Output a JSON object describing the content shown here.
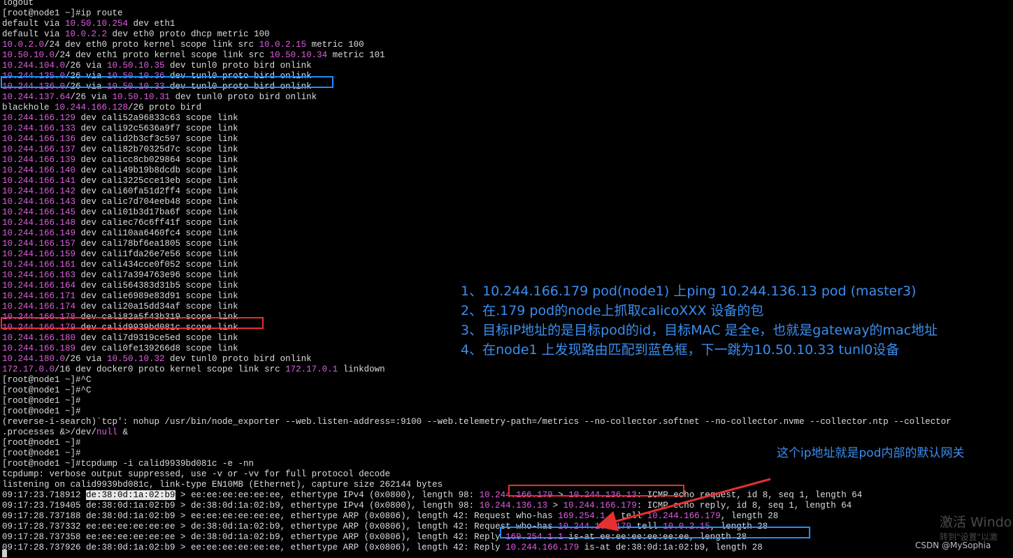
{
  "terminal": {
    "lines": [
      {
        "parts": [
          {
            "t": "logout"
          }
        ]
      },
      {
        "parts": [
          {
            "t": "[root@node1 ~]#ip route"
          }
        ]
      },
      {
        "parts": [
          {
            "t": "default via "
          },
          {
            "t": "10.50.10.254",
            "c": "ip"
          },
          {
            "t": " dev eth1"
          }
        ]
      },
      {
        "parts": [
          {
            "t": "default via "
          },
          {
            "t": "10.0.2.2",
            "c": "ip"
          },
          {
            "t": " dev eth0 proto dhcp metric 100"
          }
        ]
      },
      {
        "parts": [
          {
            "t": "10.0.2.0",
            "c": "ip"
          },
          {
            "t": "/24 dev eth0 proto kernel scope link src "
          },
          {
            "t": "10.0.2.15",
            "c": "ip"
          },
          {
            "t": " metric 100"
          }
        ]
      },
      {
        "parts": [
          {
            "t": "10.50.10.0",
            "c": "ip"
          },
          {
            "t": "/24 dev eth1 proto kernel scope link src "
          },
          {
            "t": "10.50.10.34",
            "c": "ip"
          },
          {
            "t": " metric 101"
          }
        ]
      },
      {
        "parts": [
          {
            "t": "10.244.104.0",
            "c": "ip"
          },
          {
            "t": "/26 via "
          },
          {
            "t": "10.50.10.35",
            "c": "ip"
          },
          {
            "t": " dev tunl0 proto bird onlink"
          }
        ]
      },
      {
        "parts": [
          {
            "t": "10.244.135.0",
            "c": "ip"
          },
          {
            "t": "/26 via "
          },
          {
            "t": "10.50.10.36",
            "c": "ip"
          },
          {
            "t": " dev tunl0 proto bird onlink"
          }
        ]
      },
      {
        "parts": [
          {
            "t": "10.244.136.0",
            "c": "ip"
          },
          {
            "t": "/26 via "
          },
          {
            "t": "10.50.10.33",
            "c": "ip"
          },
          {
            "t": " dev tunl0 proto bird onlink"
          }
        ]
      },
      {
        "parts": [
          {
            "t": "10.244.137.64",
            "c": "ip"
          },
          {
            "t": "/26 via "
          },
          {
            "t": "10.50.10.31",
            "c": "ip"
          },
          {
            "t": " dev tunl0 proto bird onlink"
          }
        ]
      },
      {
        "parts": [
          {
            "t": "blackhole "
          },
          {
            "t": "10.244.166.128",
            "c": "ip"
          },
          {
            "t": "/26 proto bird"
          }
        ]
      },
      {
        "parts": [
          {
            "t": "10.244.166.129",
            "c": "ip"
          },
          {
            "t": " dev cali52a96833c63 scope link"
          }
        ]
      },
      {
        "parts": [
          {
            "t": "10.244.166.133",
            "c": "ip"
          },
          {
            "t": " dev cali92c5636a9f7 scope link"
          }
        ]
      },
      {
        "parts": [
          {
            "t": "10.244.166.136",
            "c": "ip"
          },
          {
            "t": " dev calid2b3cf3c597 scope link"
          }
        ]
      },
      {
        "parts": [
          {
            "t": "10.244.166.137",
            "c": "ip"
          },
          {
            "t": " dev cali82b70325d7c scope link"
          }
        ]
      },
      {
        "parts": [
          {
            "t": "10.244.166.139",
            "c": "ip"
          },
          {
            "t": " dev calicc8cb029864 scope link"
          }
        ]
      },
      {
        "parts": [
          {
            "t": "10.244.166.140",
            "c": "ip"
          },
          {
            "t": " dev cali49b19b8dcdb scope link"
          }
        ]
      },
      {
        "parts": [
          {
            "t": "10.244.166.141",
            "c": "ip"
          },
          {
            "t": " dev cali3225cce13eb scope link"
          }
        ]
      },
      {
        "parts": [
          {
            "t": "10.244.166.142",
            "c": "ip"
          },
          {
            "t": " dev cali60fa51d2ff4 scope link"
          }
        ]
      },
      {
        "parts": [
          {
            "t": "10.244.166.143",
            "c": "ip"
          },
          {
            "t": " dev calic7d704eeb48 scope link"
          }
        ]
      },
      {
        "parts": [
          {
            "t": "10.244.166.145",
            "c": "ip"
          },
          {
            "t": " dev cali01b3d17ba6f scope link"
          }
        ]
      },
      {
        "parts": [
          {
            "t": "10.244.166.148",
            "c": "ip"
          },
          {
            "t": " dev caliec76c6ff41f scope link"
          }
        ]
      },
      {
        "parts": [
          {
            "t": "10.244.166.149",
            "c": "ip"
          },
          {
            "t": " dev cali10aa6460fc4 scope link"
          }
        ]
      },
      {
        "parts": [
          {
            "t": "10.244.166.157",
            "c": "ip"
          },
          {
            "t": " dev cali78bf6ea1805 scope link"
          }
        ]
      },
      {
        "parts": [
          {
            "t": "10.244.166.159",
            "c": "ip"
          },
          {
            "t": " dev cali1fda26e7e56 scope link"
          }
        ]
      },
      {
        "parts": [
          {
            "t": "10.244.166.161",
            "c": "ip"
          },
          {
            "t": " dev cali434cce0f052 scope link"
          }
        ]
      },
      {
        "parts": [
          {
            "t": "10.244.166.163",
            "c": "ip"
          },
          {
            "t": " dev cali7a394763e96 scope link"
          }
        ]
      },
      {
        "parts": [
          {
            "t": "10.244.166.164",
            "c": "ip"
          },
          {
            "t": " dev cali564383d31b5 scope link"
          }
        ]
      },
      {
        "parts": [
          {
            "t": "10.244.166.171",
            "c": "ip"
          },
          {
            "t": " dev calie6989e83d91 scope link"
          }
        ]
      },
      {
        "parts": [
          {
            "t": "10.244.166.174",
            "c": "ip"
          },
          {
            "t": " dev cali20a15dd34af scope link"
          }
        ]
      },
      {
        "parts": [
          {
            "t": "10.244.166.178",
            "c": "ip"
          },
          {
            "t": " dev cali82a5f43b319 scope link"
          }
        ]
      },
      {
        "parts": [
          {
            "t": "10.244.166.179",
            "c": "ip"
          },
          {
            "t": " dev calid9939bd081c scope link"
          }
        ]
      },
      {
        "parts": [
          {
            "t": "10.244.166.180",
            "c": "ip"
          },
          {
            "t": " dev cali7d9319ce5ed scope link"
          }
        ]
      },
      {
        "parts": [
          {
            "t": "10.244.166.189",
            "c": "ip"
          },
          {
            "t": " dev cali0fe139266d8 scope link"
          }
        ]
      },
      {
        "parts": [
          {
            "t": "10.244.180.0",
            "c": "ip"
          },
          {
            "t": "/26 via "
          },
          {
            "t": "10.50.10.32",
            "c": "ip"
          },
          {
            "t": " dev tunl0 proto bird onlink"
          }
        ]
      },
      {
        "parts": [
          {
            "t": "172.17.0.0",
            "c": "ip"
          },
          {
            "t": "/16 dev docker0 proto kernel scope link src "
          },
          {
            "t": "172.17.0.1",
            "c": "ip"
          },
          {
            "t": " linkdown"
          }
        ]
      },
      {
        "parts": [
          {
            "t": "[root@node1 ~]#^C"
          }
        ]
      },
      {
        "parts": [
          {
            "t": "[root@node1 ~]#^C"
          }
        ]
      },
      {
        "parts": [
          {
            "t": "[root@node1 ~]#"
          }
        ]
      },
      {
        "parts": [
          {
            "t": "[root@node1 ~]#"
          }
        ]
      },
      {
        "parts": [
          {
            "t": "(reverse-i-search)`tcp': nohup /usr/bin/node_exporter --web.listen-address=:9100 --web.telemetry-path=/metrics --no-collector.softnet --no-collector.nvme --collector.ntp --collector"
          }
        ]
      },
      {
        "parts": [
          {
            "t": ".processes &>/dev/"
          },
          {
            "t": "null",
            "c": "ip"
          },
          {
            "t": " &"
          }
        ]
      },
      {
        "parts": [
          {
            "t": "[root@node1 ~]#"
          }
        ]
      },
      {
        "parts": [
          {
            "t": "[root@node1 ~]#"
          }
        ]
      },
      {
        "parts": [
          {
            "t": "[root@node1 ~]#tcpdump -i calid9939bd081c -e -nn"
          }
        ]
      },
      {
        "parts": [
          {
            "t": "tcpdump: verbose output suppressed, use -v or -vv for full protocol decode"
          }
        ]
      },
      {
        "parts": [
          {
            "t": "listening on calid9939bd081c, link-type EN10MB (Ethernet), capture size 262144 bytes"
          }
        ]
      },
      {
        "parts": [
          {
            "t": "09:17:23.718912 "
          },
          {
            "t": "de:38:0d:1a:02:b9",
            "c": "sel"
          },
          {
            "t": " > ee:ee:ee:ee:ee:ee, ethertype IPv4 (0x0800), length 98: "
          },
          {
            "t": "10.244.166.179",
            "c": "ip"
          },
          {
            "t": " > "
          },
          {
            "t": "10.244.136.13",
            "c": "ip"
          },
          {
            "t": ": ICMP echo request, id 8, seq 1, length 64"
          }
        ]
      },
      {
        "parts": [
          {
            "t": "09:17:23.719405 de:38:0d:1a:02:b9 > de:38:0d:1a:02:b9, ethertype IPv4 (0x0800), length 98: "
          },
          {
            "t": "10.244.136.13",
            "c": "ip"
          },
          {
            "t": " > "
          },
          {
            "t": "10.244.166.179",
            "c": "ip"
          },
          {
            "t": ": ICMP echo reply, id 8, seq 1, length 64"
          }
        ]
      },
      {
        "parts": [
          {
            "t": "09:17:28.737188 de:38:0d:1a:02:b9 > ee:ee:ee:ee:ee:ee, ethertype ARP (0x0806), length 42: Request who-has "
          },
          {
            "t": "169.254.1.1",
            "c": "ip"
          },
          {
            "t": " tell "
          },
          {
            "t": "10.244.166.179",
            "c": "ip"
          },
          {
            "t": ", length 28"
          }
        ]
      },
      {
        "parts": [
          {
            "t": "09:17:28.737332 ee:ee:ee:ee:ee:ee > de:38:0d:1a:02:b9, ethertype ARP (0x0806), length 42: Request who-has "
          },
          {
            "t": "10.244.166.179",
            "c": "ip"
          },
          {
            "t": " tell "
          },
          {
            "t": "10.0.2.15",
            "c": "ip"
          },
          {
            "t": ", length 28"
          }
        ]
      },
      {
        "parts": [
          {
            "t": "09:17:28.737358 ee:ee:ee:ee:ee:ee > de:38:0d:1a:02:b9, ethertype ARP (0x0806), length 42: Reply "
          },
          {
            "t": "169.254.1.1",
            "c": "ip"
          },
          {
            "t": " is-at ee:ee:ee:ee:ee:ee, length 28"
          }
        ]
      },
      {
        "parts": [
          {
            "t": "09:17:28.737926 de:38:0d:1a:02:b9 > ee:ee:ee:ee:ee:ee, ethertype ARP (0x0806), length 42: Reply "
          },
          {
            "t": "10.244.166.179",
            "c": "ip"
          },
          {
            "t": " is-at de:38:0d:1a:02:b9, length 28"
          }
        ]
      }
    ]
  },
  "annotations": {
    "notes": [
      "1、10.244.166.179 pod(node1) 上ping 10.244.136.13 pod (master3)",
      "2、在.179 pod的node上抓取calicoXXX 设备的包",
      "3、目标IP地址的是目标pod的id，目标MAC 是全e，也就是gateway的mac地址",
      "4、在node1 上发现路由匹配到蓝色框，下一跳为10.50.10.33 tunl0设备"
    ],
    "gateway_note": "这个ip地址就是pod内部的默认网关"
  },
  "watermark": {
    "windows": "激活 Windo",
    "windows_sub": "转到\"设置\"以激",
    "csdn": "CSDN @MySophia"
  },
  "colors": {
    "background": "#000000",
    "text": "#dcdcdc",
    "ip_highlight": "#e05ee0",
    "annotation": "#3b8ef0",
    "red_box": "#e53030",
    "blue_box": "#1e90ff"
  }
}
